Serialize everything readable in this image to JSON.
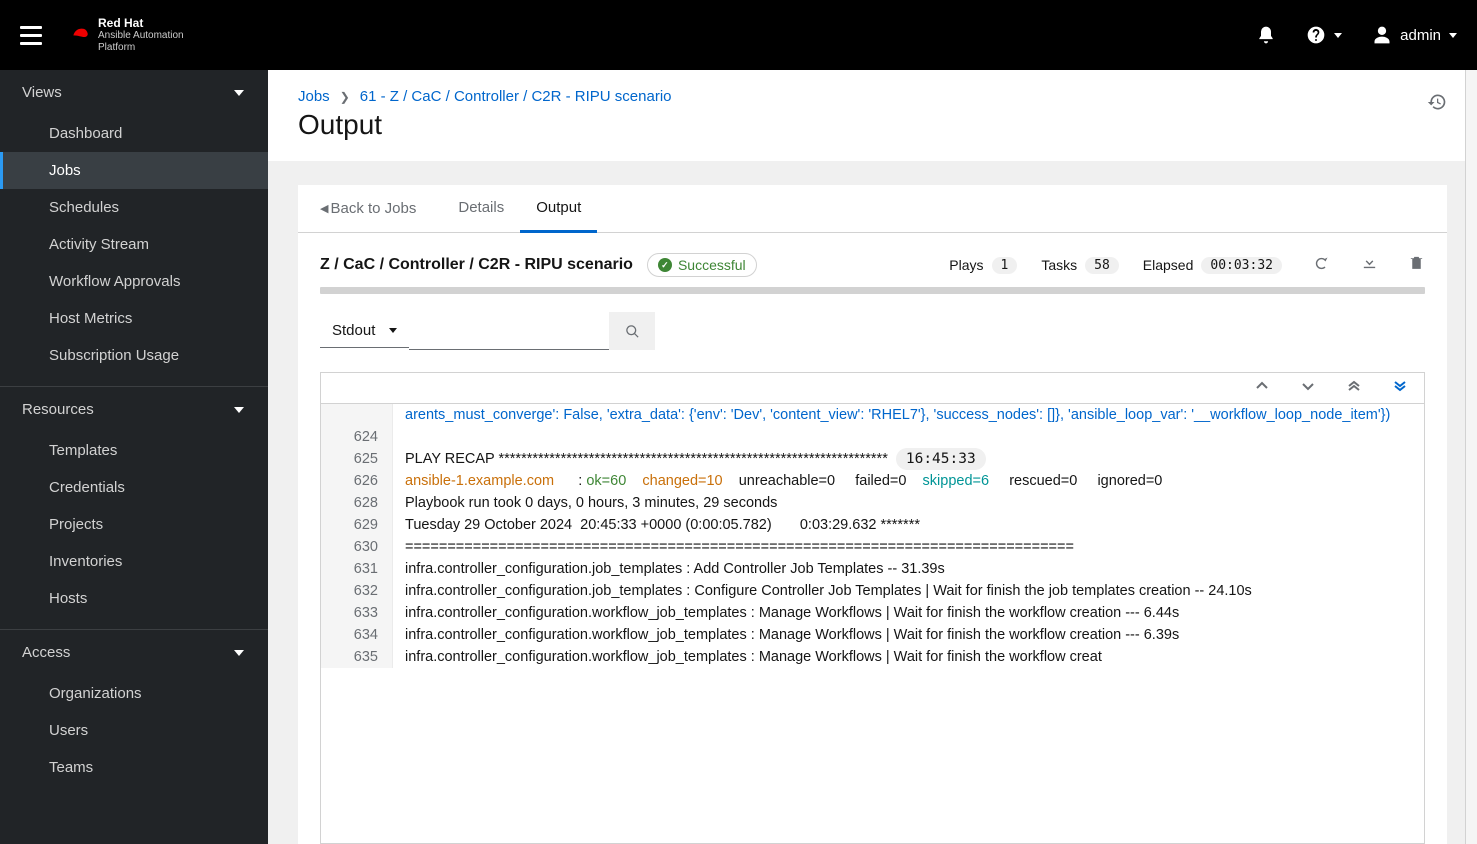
{
  "brand": {
    "name": "Red Hat",
    "product_line1": "Ansible Automation",
    "product_line2": "Platform"
  },
  "user": {
    "name": "admin"
  },
  "sidebar": {
    "groups": [
      {
        "label": "Views",
        "items": [
          {
            "label": "Dashboard",
            "active": false
          },
          {
            "label": "Jobs",
            "active": true
          },
          {
            "label": "Schedules",
            "active": false
          },
          {
            "label": "Activity Stream",
            "active": false
          },
          {
            "label": "Workflow Approvals",
            "active": false
          },
          {
            "label": "Host Metrics",
            "active": false
          },
          {
            "label": "Subscription Usage",
            "active": false
          }
        ]
      },
      {
        "label": "Resources",
        "items": [
          {
            "label": "Templates",
            "active": false
          },
          {
            "label": "Credentials",
            "active": false
          },
          {
            "label": "Projects",
            "active": false
          },
          {
            "label": "Inventories",
            "active": false
          },
          {
            "label": "Hosts",
            "active": false
          }
        ]
      },
      {
        "label": "Access",
        "items": [
          {
            "label": "Organizations",
            "active": false
          },
          {
            "label": "Users",
            "active": false
          },
          {
            "label": "Teams",
            "active": false
          }
        ]
      }
    ]
  },
  "breadcrumb": {
    "root": "Jobs",
    "current": "61 - Z / CaC / Controller / C2R - RIPU scenario"
  },
  "page_title": "Output",
  "tabs": {
    "back": "Back to Jobs",
    "details": "Details",
    "output": "Output"
  },
  "job": {
    "title": "Z / CaC / Controller / C2R - RIPU scenario",
    "status": "Successful",
    "plays_label": "Plays",
    "plays": "1",
    "tasks_label": "Tasks",
    "tasks": "58",
    "elapsed_label": "Elapsed",
    "elapsed": "00:03:32"
  },
  "filter": {
    "dropdown": "Stdout"
  },
  "output": {
    "frag_top": "arents_must_converge': False, 'extra_data': {'env': 'Dev', 'content_view': 'RHEL7'}, 'success_nodes': []}, 'ansible_loop_var': '__workflow_loop_node_item'})",
    "lines": [
      {
        "n": "624",
        "text": ""
      },
      {
        "n": "625",
        "recap_prefix": "PLAY RECAP ",
        "recap_stars": "*********************************************************************",
        "timestamp": "16:45:33"
      },
      {
        "n": "626",
        "host": "ansible-1.example.com",
        "colon": "      : ",
        "ok": "ok=60",
        "gap1": "    ",
        "changed": "changed=10",
        "gap2": "    ",
        "static1": "unreachable=0     failed=0    ",
        "skipped": "skipped=6",
        "gap3": "     ",
        "static2": "rescued=0     ignored=0"
      },
      {
        "n": "628",
        "text": "Playbook run took 0 days, 0 hours, 3 minutes, 29 seconds"
      },
      {
        "n": "629",
        "text": "Tuesday 29 October 2024  20:45:33 +0000 (0:00:05.782)       0:03:29.632 *******"
      },
      {
        "n": "630",
        "text": "==============================================================================="
      },
      {
        "n": "631",
        "text": "infra.controller_configuration.job_templates : Add Controller Job Templates -- 31.39s"
      },
      {
        "n": "632",
        "text": "infra.controller_configuration.job_templates : Configure Controller Job Templates | Wait for finish the job templates creation -- 24.10s"
      },
      {
        "n": "633",
        "text": "infra.controller_configuration.workflow_job_templates : Manage Workflows | Wait for finish the workflow creation --- 6.44s"
      },
      {
        "n": "634",
        "text": "infra.controller_configuration.workflow_job_templates : Manage Workflows | Wait for finish the workflow creation --- 6.39s"
      },
      {
        "n": "635",
        "text": "infra.controller_configuration.workflow_job_templates : Manage Workflows | Wait for finish the workflow creat"
      }
    ]
  }
}
